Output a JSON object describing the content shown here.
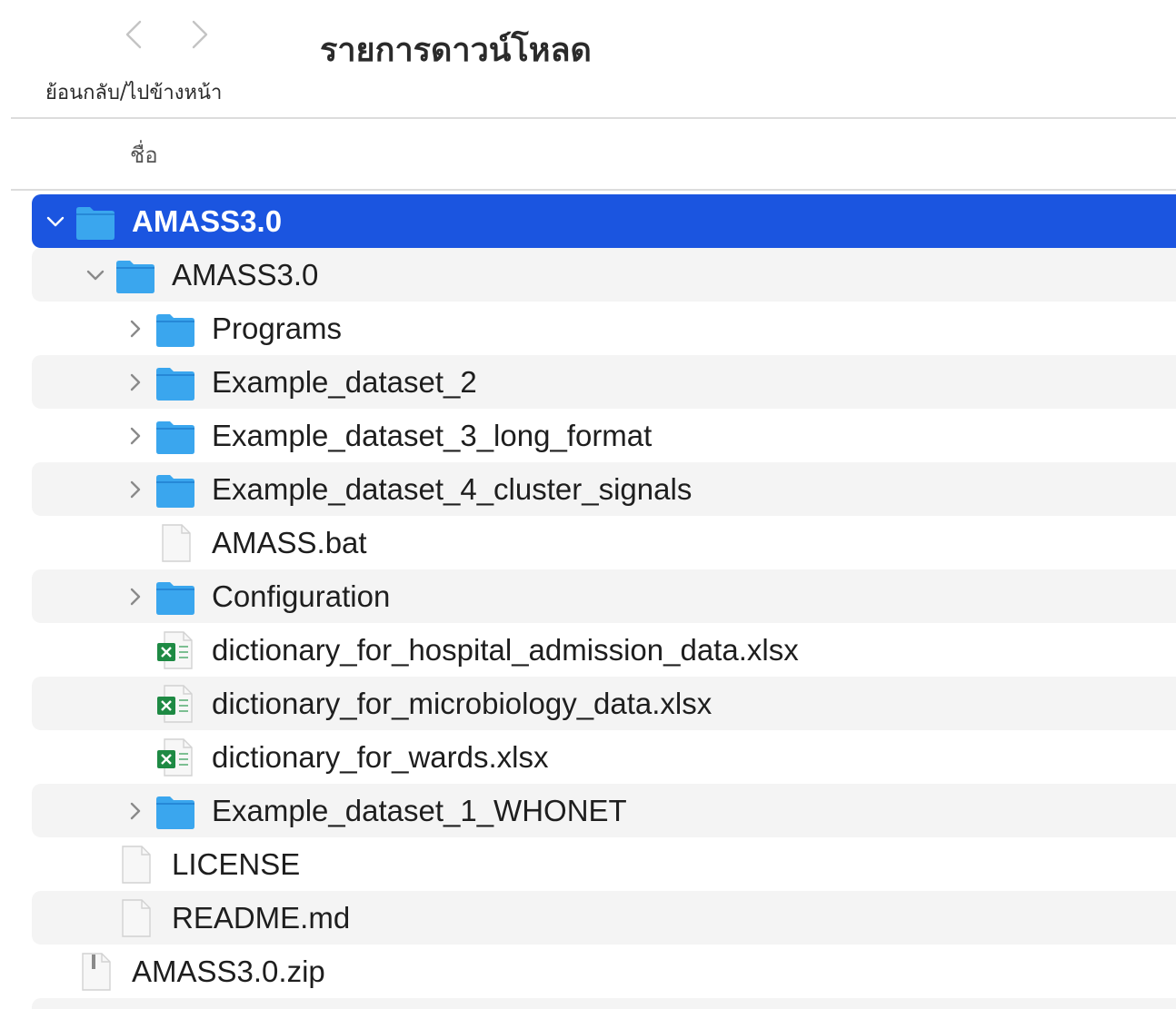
{
  "toolbar": {
    "title": "รายการดาวน์โหลด",
    "nav_label": "ย้อนกลับ/ไปข้างหน้า"
  },
  "columns": {
    "name": "ชื่อ"
  },
  "colors": {
    "selection": "#1b55e0",
    "folder": "#3aa6ee",
    "excel": "#1e8a44"
  },
  "rows": [
    {
      "label": "AMASS3.0",
      "depth": 0,
      "kind": "folder",
      "expanded": true,
      "selected": true
    },
    {
      "label": "AMASS3.0",
      "depth": 1,
      "kind": "folder",
      "expanded": true
    },
    {
      "label": "Programs",
      "depth": 2,
      "kind": "folder",
      "expanded": false
    },
    {
      "label": "Example_dataset_2",
      "depth": 2,
      "kind": "folder",
      "expanded": false
    },
    {
      "label": "Example_dataset_3_long_format",
      "depth": 2,
      "kind": "folder",
      "expanded": false
    },
    {
      "label": "Example_dataset_4_cluster_signals",
      "depth": 2,
      "kind": "folder",
      "expanded": false
    },
    {
      "label": "AMASS.bat",
      "depth": 2,
      "kind": "file"
    },
    {
      "label": "Configuration",
      "depth": 2,
      "kind": "folder",
      "expanded": false
    },
    {
      "label": "dictionary_for_hospital_admission_data.xlsx",
      "depth": 2,
      "kind": "excel"
    },
    {
      "label": "dictionary_for_microbiology_data.xlsx",
      "depth": 2,
      "kind": "excel"
    },
    {
      "label": "dictionary_for_wards.xlsx",
      "depth": 2,
      "kind": "excel"
    },
    {
      "label": "Example_dataset_1_WHONET",
      "depth": 2,
      "kind": "folder",
      "expanded": false
    },
    {
      "label": "LICENSE",
      "depth": 1,
      "kind": "file"
    },
    {
      "label": "README.md",
      "depth": 1,
      "kind": "file"
    },
    {
      "label": "AMASS3.0.zip",
      "depth": 0,
      "kind": "zip"
    }
  ]
}
